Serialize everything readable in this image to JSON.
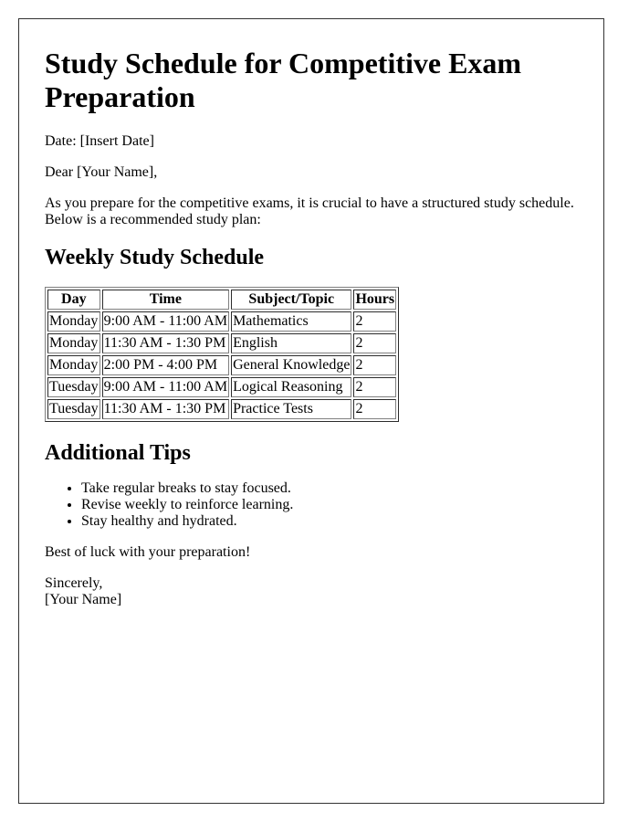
{
  "document": {
    "title": "Study Schedule for Competitive Exam Preparation",
    "date_line": "Date: [Insert Date]",
    "salutation": "Dear [Your Name],",
    "intro": "As you prepare for the competitive exams, it is crucial to have a structured study schedule. Below is a recommended study plan:",
    "schedule_heading": "Weekly Study Schedule",
    "schedule_table": {
      "headers": [
        "Day",
        "Time",
        "Subject/Topic",
        "Hours"
      ],
      "rows": [
        [
          "Monday",
          "9:00 AM - 11:00 AM",
          "Mathematics",
          "2"
        ],
        [
          "Monday",
          "11:30 AM - 1:30 PM",
          "English",
          "2"
        ],
        [
          "Monday",
          "2:00 PM - 4:00 PM",
          "General Knowledge",
          "2"
        ],
        [
          "Tuesday",
          "9:00 AM - 11:00 AM",
          "Logical Reasoning",
          "2"
        ],
        [
          "Tuesday",
          "11:30 AM - 1:30 PM",
          "Practice Tests",
          "2"
        ]
      ]
    },
    "tips_heading": "Additional Tips",
    "tips": [
      "Take regular breaks to stay focused.",
      "Revise weekly to reinforce learning.",
      "Stay healthy and hydrated."
    ],
    "closing_wish": "Best of luck with your preparation!",
    "closing": "Sincerely,",
    "signature": "[Your Name]"
  }
}
